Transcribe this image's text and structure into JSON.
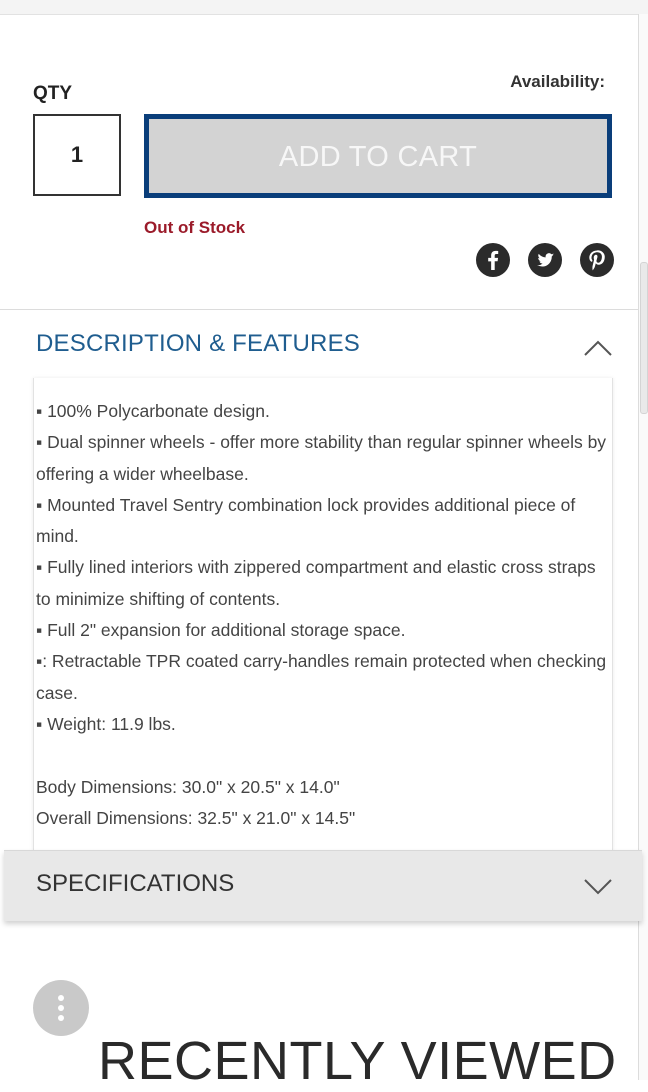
{
  "purchase": {
    "qty_label": "QTY",
    "qty_value": "1",
    "availability_label": "Availability:",
    "add_to_cart_label": "ADD TO CART",
    "stock_status": "Out of Stock"
  },
  "social": {
    "icons": [
      "facebook-icon",
      "twitter-icon",
      "pinterest-icon"
    ]
  },
  "description": {
    "title": "DESCRIPTION & FEATURES",
    "expanded": true,
    "bullets": [
      "▪ 100% Polycarbonate design.",
      "▪ Dual spinner wheels - offer more stability than regular spinner wheels by offering a wider wheelbase.",
      "▪ Mounted Travel Sentry combination lock provides additional piece of mind.",
      "▪ Fully lined interiors with zippered compartment and elastic cross straps to minimize shifting of contents.",
      "▪ Full 2\" expansion for additional storage space.",
      "▪: Retractable TPR coated carry-handles remain protected when checking case.",
      "▪ Weight: 11.9 lbs."
    ],
    "body_dimensions": "Body Dimensions: 30.0\" x 20.5\" x 14.0\"",
    "overall_dimensions": "Overall Dimensions: 32.5\" x 21.0\" x 14.5\""
  },
  "specifications": {
    "title": "SPECIFICATIONS",
    "expanded": false
  },
  "recently_viewed": {
    "title": "RECENTLY VIEWED"
  },
  "colors": {
    "cart_border": "#0a3e7a",
    "cart_fill": "#d3d3d3",
    "out_of_stock": "#9b1b2a",
    "section_title": "#1f5d8f"
  }
}
